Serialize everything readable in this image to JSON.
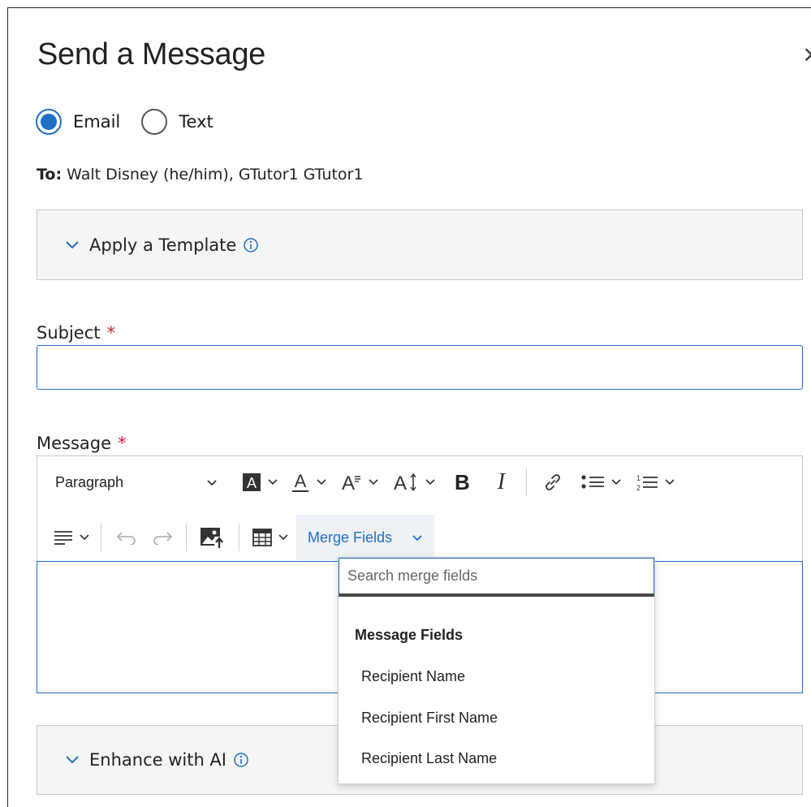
{
  "dialog": {
    "title": "Send a Message",
    "close_glyph": "×"
  },
  "delivery": {
    "options": [
      {
        "label": "Email",
        "checked": true
      },
      {
        "label": "Text",
        "checked": false
      }
    ]
  },
  "recipients": {
    "prefix": "To:",
    "names": "Walt Disney (he/him), GTutor1 GTutor1"
  },
  "template": {
    "label": "Apply a Template",
    "icon": "info-icon"
  },
  "subject": {
    "label": "Subject",
    "required_mark": "*",
    "value": ""
  },
  "message": {
    "label": "Message",
    "required_mark": "*",
    "toolbar": {
      "paragraph_label": "Paragraph",
      "bold_glyph": "B",
      "italic_glyph": "I",
      "merge_fields_label": "Merge Fields"
    },
    "value": ""
  },
  "merge_dropdown": {
    "search_placeholder": "Search merge fields",
    "heading": "Message Fields",
    "items": [
      "Recipient Name",
      "Recipient First Name",
      "Recipient Last Name"
    ]
  },
  "ai": {
    "label": "Enhance with AI",
    "icon": "info-icon"
  },
  "colors": {
    "accent": "#1f6fc5",
    "required": "#c0272d",
    "panel_bg": "#f5f5f5"
  }
}
